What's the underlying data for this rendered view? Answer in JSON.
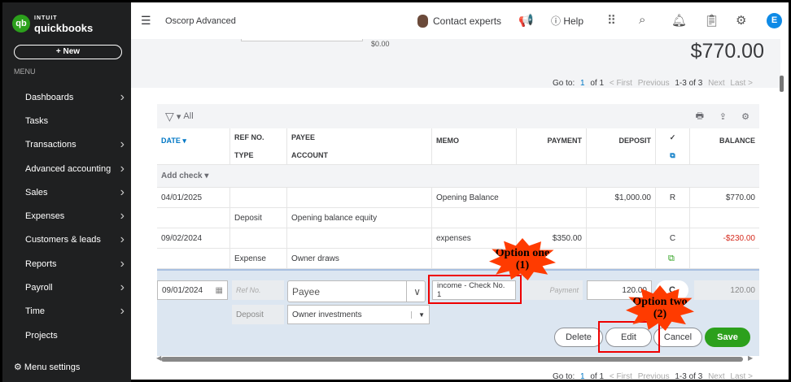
{
  "sidebar": {
    "logo_brand": "INTUIT",
    "logo_name": "quickbooks",
    "new_label": "+ New",
    "menu_label": "MENU",
    "items": [
      "Dashboards",
      "Tasks",
      "Transactions",
      "Advanced accounting",
      "Sales",
      "Expenses",
      "Customers & leads",
      "Reports",
      "Payroll",
      "Time",
      "Projects"
    ],
    "menu_settings": "Menu settings"
  },
  "header": {
    "company": "Oscorp Advanced",
    "contact": "Contact experts",
    "help": "Help",
    "avatar": "E"
  },
  "summary": {
    "balance": "$770.00",
    "partial_value": "$0.00"
  },
  "pagination": {
    "goto": "Go to:",
    "page": "1",
    "of": "of 1",
    "first": "< First",
    "previous": "Previous",
    "range": "1-3 of 3",
    "next": "Next",
    "last": "Last >"
  },
  "table": {
    "filter": "All",
    "headers": {
      "date": "DATE ▾",
      "ref": "REF NO.",
      "type": "TYPE",
      "payee": "PAYEE",
      "account": "ACCOUNT",
      "memo": "MEMO",
      "payment": "PAYMENT",
      "deposit": "DEPOSIT",
      "check": "✓",
      "balance": "BALANCE"
    },
    "add_check": "Add check",
    "rows": [
      {
        "date": "04/01/2025",
        "type": "Deposit",
        "account": "Opening balance equity",
        "memo": "Opening Balance",
        "payment": "",
        "deposit": "$1,000.00",
        "status": "R",
        "balance": "$770.00"
      },
      {
        "date": "09/02/2024",
        "type": "Expense",
        "account": "Owner draws",
        "memo": "expenses",
        "payment": "$350.00",
        "deposit": "",
        "status": "C",
        "balance": "-$230.00"
      }
    ],
    "edit": {
      "date": "09/01/2024",
      "ref_placeholder": "Ref No.",
      "payee_placeholder": "Payee",
      "memo": "income - Check No. 1",
      "payment_placeholder": "Payment",
      "deposit": "120.00",
      "status": "C",
      "balance": "120.00",
      "type": "Deposit",
      "account": "Owner investments",
      "delete": "Delete",
      "edit": "Edit",
      "cancel": "Cancel",
      "save": "Save"
    }
  },
  "annotations": {
    "one": "Option one (1)",
    "two": "Option two (2)"
  },
  "colors": {
    "brand": "#2ca01c",
    "negative": "#d52b1e",
    "annotation": "#ff3b00"
  }
}
